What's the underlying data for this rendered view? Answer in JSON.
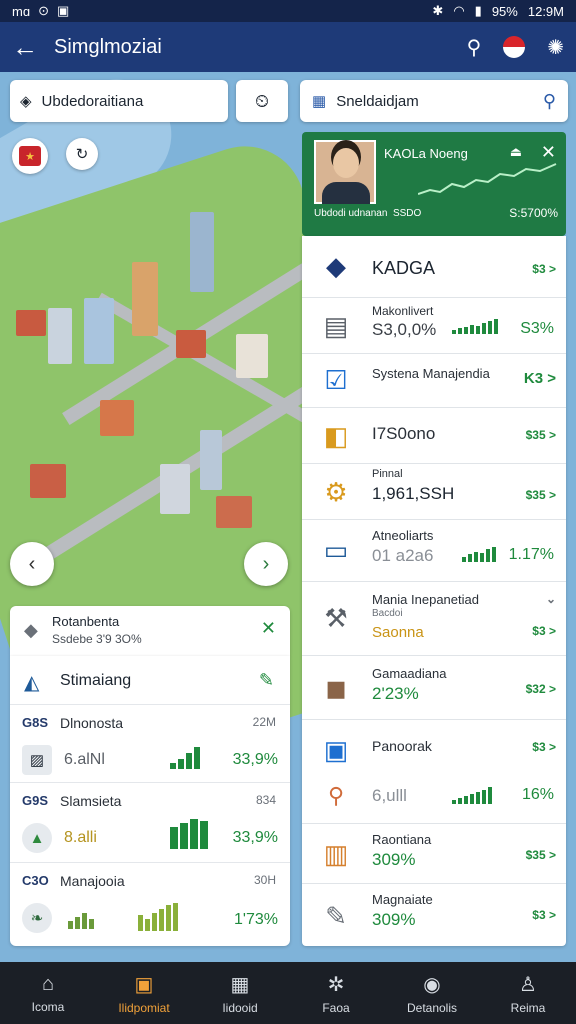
{
  "status_bar": {
    "left_text": "mɑ",
    "battery": "95%",
    "time": "12:9M"
  },
  "app_bar": {
    "title": "Simglmoziai"
  },
  "map": {
    "search_left": "Ubdedoraitiana",
    "search_right": "Sneldaidjam"
  },
  "profile": {
    "name": "KAOLa Noeng",
    "subtitle": "Ubdodi udnanan",
    "value_mid": "SSDO",
    "value": "S:5700%"
  },
  "right_list": [
    {
      "icon": "compass-logo-icon",
      "title": "KADGA",
      "value": "",
      "change": "$3 >"
    },
    {
      "icon": "document-icon",
      "title": "Makonlivert",
      "value": "S3,0,0%",
      "pct": "S3%",
      "bars": [
        3,
        5,
        6,
        8,
        7,
        9,
        10,
        12
      ]
    },
    {
      "icon": "checkbox-icon",
      "title": "Systena Manajendia",
      "value": "",
      "change": "K3 >"
    },
    {
      "icon": "coins-icon",
      "title": "I7S0ono",
      "value": "",
      "change": "$35 >"
    },
    {
      "icon": "gear-icon",
      "title": "Pinnal",
      "value": "1,961,SSH",
      "change": "$35 >"
    },
    {
      "icon": "monitor-icon",
      "title": "Atneoliarts",
      "value": "01 a2a6",
      "pct": "1.17%",
      "bars": [
        4,
        6,
        8,
        7,
        10,
        12
      ]
    },
    {
      "icon": "wrench-icon",
      "title": "Mania Inepanetiad",
      "value": "Saonna",
      "sub": "Bacdoi",
      "change": "$3 >"
    },
    {
      "icon": "blocks-icon",
      "title": "Gamaadiana",
      "value": "2'23%",
      "change": "$32 >"
    },
    {
      "icon": "chart-doc-icon",
      "title": "Panoorak",
      "value": "6,ulll",
      "pct": "16%",
      "change": "$3 >",
      "bars": [
        4,
        6,
        8,
        9,
        10,
        12,
        14
      ]
    },
    {
      "icon": "building-icon",
      "title": "Raontiana",
      "value": "309%",
      "change": "$35 >"
    },
    {
      "icon": "tools-icon",
      "title": "Magnaiate",
      "value": "309%",
      "change": "$3 >"
    }
  ],
  "left_head": {
    "title": "Rotanbenta",
    "subtitle": "Ssdebe 3'9 3O%"
  },
  "left_panel": {
    "title": "Stimaiang",
    "items": [
      {
        "tag": "G8S",
        "name": "Dlnonosta",
        "side": "22M",
        "value": "6.alNl",
        "pct": "33,9%"
      },
      {
        "tag": "G9S",
        "name": "Slamsieta",
        "side": "834",
        "value": "8.alli",
        "pct": "33,9%"
      },
      {
        "tag": "C3O",
        "name": "Manajooia",
        "side": "30H",
        "value": "",
        "pct": "1'73%"
      }
    ]
  },
  "bottom_nav": [
    {
      "icon": "home-icon",
      "label": "Icoma"
    },
    {
      "icon": "briefcase-icon",
      "label": "Ilidpomiat"
    },
    {
      "icon": "grid-icon",
      "label": "Iidooid"
    },
    {
      "icon": "globe-icon",
      "label": "Faoa"
    },
    {
      "icon": "check-circle-icon",
      "label": "Detanolis"
    },
    {
      "icon": "person-icon",
      "label": "Reima"
    }
  ],
  "colors": {
    "header": "#1e3a78",
    "accent_green": "#1f8a3d",
    "active_nav": "#f0a13a"
  }
}
